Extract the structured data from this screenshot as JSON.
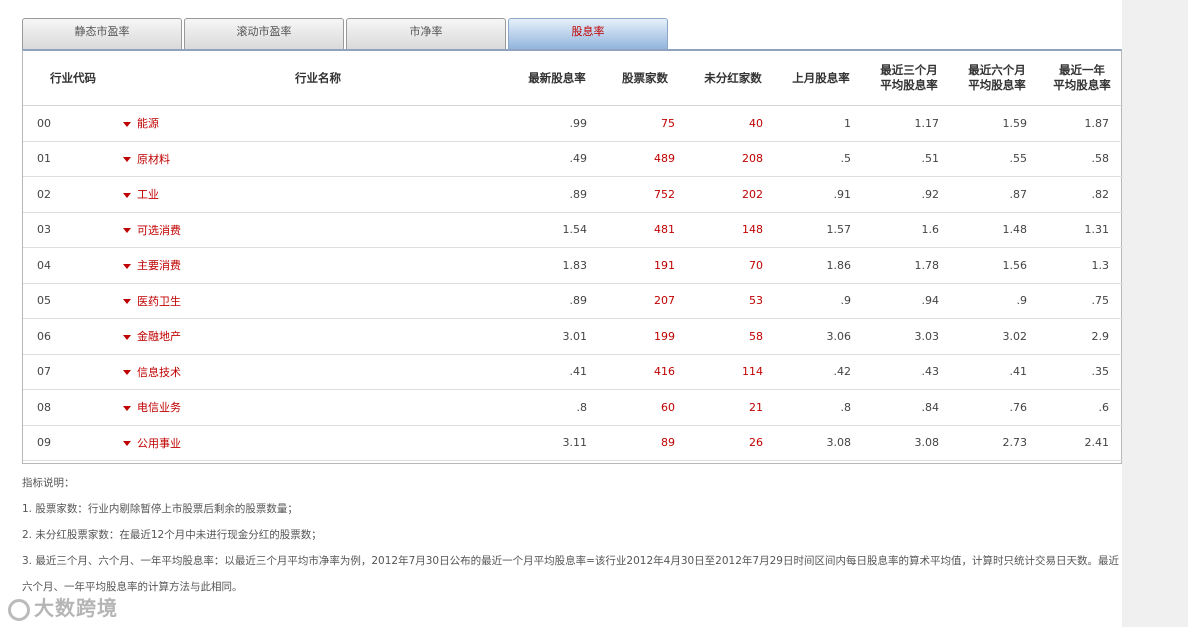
{
  "tabs": [
    {
      "label": "静态市盈率",
      "active": false
    },
    {
      "label": "滚动市盈率",
      "active": false
    },
    {
      "label": "市净率",
      "active": false
    },
    {
      "label": "股息率",
      "active": true
    }
  ],
  "table": {
    "headers": {
      "code": "行业代码",
      "name": "行业名称",
      "latest": "最新股息率",
      "stocks": "股票家数",
      "nodiv": "未分红家数",
      "lastmonth": "上月股息率",
      "avg3m": [
        "最近三个月",
        "平均股息率"
      ],
      "avg6m": [
        "最近六个月",
        "平均股息率"
      ],
      "avg1y": [
        "最近一年",
        "平均股息率"
      ]
    },
    "rows": [
      {
        "code": "00",
        "name": "能源",
        "latest": ".99",
        "stocks": "75",
        "nodiv": "40",
        "lastmonth": "1",
        "avg3m": "1.17",
        "avg6m": "1.59",
        "avg1y": "1.87"
      },
      {
        "code": "01",
        "name": "原材料",
        "latest": ".49",
        "stocks": "489",
        "nodiv": "208",
        "lastmonth": ".5",
        "avg3m": ".51",
        "avg6m": ".55",
        "avg1y": ".58"
      },
      {
        "code": "02",
        "name": "工业",
        "latest": ".89",
        "stocks": "752",
        "nodiv": "202",
        "lastmonth": ".91",
        "avg3m": ".92",
        "avg6m": ".87",
        "avg1y": ".82"
      },
      {
        "code": "03",
        "name": "可选消费",
        "latest": "1.54",
        "stocks": "481",
        "nodiv": "148",
        "lastmonth": "1.57",
        "avg3m": "1.6",
        "avg6m": "1.48",
        "avg1y": "1.31"
      },
      {
        "code": "04",
        "name": "主要消费",
        "latest": "1.83",
        "stocks": "191",
        "nodiv": "70",
        "lastmonth": "1.86",
        "avg3m": "1.78",
        "avg6m": "1.56",
        "avg1y": "1.3"
      },
      {
        "code": "05",
        "name": "医药卫生",
        "latest": ".89",
        "stocks": "207",
        "nodiv": "53",
        "lastmonth": ".9",
        "avg3m": ".94",
        "avg6m": ".9",
        "avg1y": ".75"
      },
      {
        "code": "06",
        "name": "金融地产",
        "latest": "3.01",
        "stocks": "199",
        "nodiv": "58",
        "lastmonth": "3.06",
        "avg3m": "3.03",
        "avg6m": "3.02",
        "avg1y": "2.9"
      },
      {
        "code": "07",
        "name": "信息技术",
        "latest": ".41",
        "stocks": "416",
        "nodiv": "114",
        "lastmonth": ".42",
        "avg3m": ".43",
        "avg6m": ".41",
        "avg1y": ".35"
      },
      {
        "code": "08",
        "name": "电信业务",
        "latest": ".8",
        "stocks": "60",
        "nodiv": "21",
        "lastmonth": ".8",
        "avg3m": ".84",
        "avg6m": ".76",
        "avg1y": ".6"
      },
      {
        "code": "09",
        "name": "公用事业",
        "latest": "3.11",
        "stocks": "89",
        "nodiv": "26",
        "lastmonth": "3.08",
        "avg3m": "3.08",
        "avg6m": "2.73",
        "avg1y": "2.41"
      }
    ]
  },
  "notes": {
    "title": "指标说明：",
    "items": [
      "1. 股票家数：行业内剔除暂停上市股票后剩余的股票数量；",
      "2. 未分红股票家数：在最近12个月中未进行现金分红的股票数；",
      "3. 最近三个月、六个月、一年平均股息率：以最近三个月平均市净率为例，2012年7月30日公布的最近一个月平均股息率=该行业2012年4月30日至2012年7月29日时间区间内每日股息率的算术平均值，计算时只统计交易日天数。最近六个月、一年平均股息率的计算方法与此相同。"
    ]
  },
  "watermark": "大数跨境"
}
